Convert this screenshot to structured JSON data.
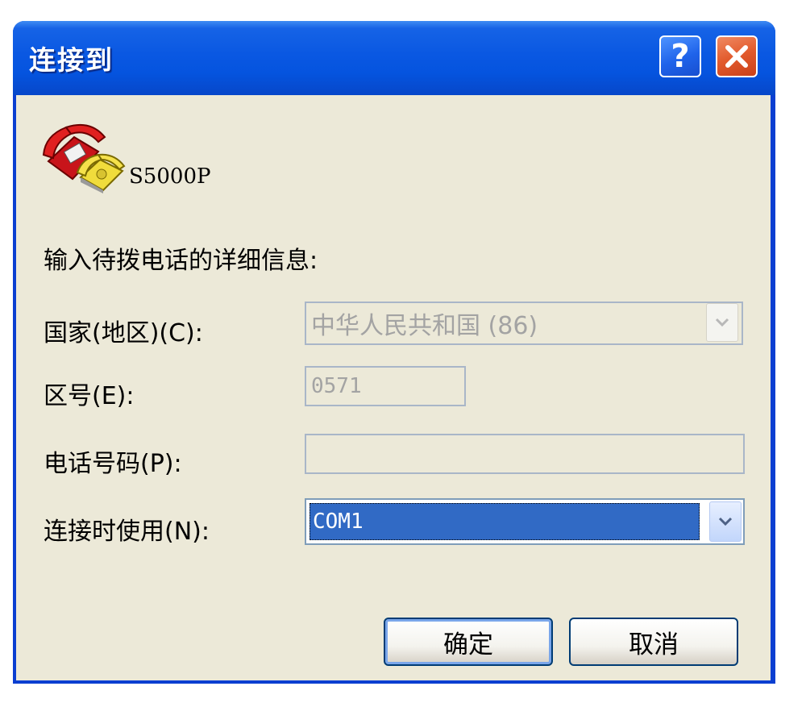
{
  "window": {
    "title": "连接到",
    "help_glyph": "?",
    "icons": {
      "help": "help-icon",
      "close": "close-icon",
      "phone": "telephone-icon"
    }
  },
  "connection_name": "S5000P",
  "instructions": "输入待拨电话的详细信息:",
  "form": {
    "country": {
      "label": "国家(地区)(C):",
      "value": "中华人民共和国 (86)",
      "disabled": true
    },
    "area_code": {
      "label": "区号(E):",
      "value": "0571",
      "disabled": true
    },
    "phone_number": {
      "label": "电话号码(P):",
      "value": "",
      "disabled": true
    },
    "connect_using": {
      "label": "连接时使用(N):",
      "value": "COM1",
      "disabled": false
    }
  },
  "buttons": {
    "ok": "确定",
    "cancel": "取消"
  },
  "colors": {
    "titlebar": "#0554df",
    "client": "#ece9d8",
    "selection": "#316ac5",
    "close": "#e25a2c"
  }
}
